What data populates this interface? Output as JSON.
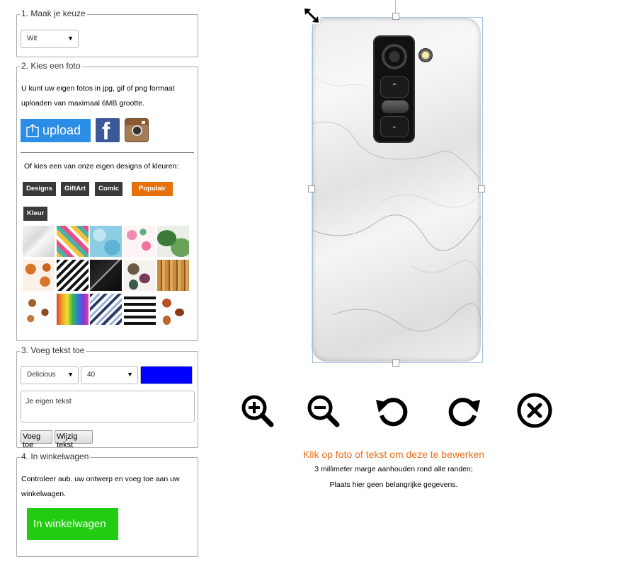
{
  "step1": {
    "legend": "1. Maak je keuze",
    "select_value": "Wit"
  },
  "step2": {
    "legend": "2. Kies een foto",
    "description": "U kunt uw eigen fotos in jpg, gif of png formaat uploaden van maximaal 6MB grootte.",
    "upload_label": "upload",
    "designs_intro": "Of kies een van onze eigen designs of kleuren:",
    "categories": [
      {
        "label": "Designs",
        "active": false
      },
      {
        "label": "GiftArt",
        "active": false
      },
      {
        "label": "Comic",
        "active": false
      },
      {
        "label": "Populair",
        "active": true
      }
    ],
    "kleur_label": "Kleur",
    "pattern_tiles": [
      {
        "name": "pattern-marble-white"
      },
      {
        "name": "pattern-pineapples"
      },
      {
        "name": "pattern-blue-glitter"
      },
      {
        "name": "pattern-flamingos"
      },
      {
        "name": "pattern-tropical-leaves"
      },
      {
        "name": "pattern-foxes"
      },
      {
        "name": "pattern-chevron-bw"
      },
      {
        "name": "pattern-marble-black"
      },
      {
        "name": "pattern-autumn-leaves"
      },
      {
        "name": "pattern-wood"
      },
      {
        "name": "pattern-dogs"
      },
      {
        "name": "pattern-rainbow-paint"
      },
      {
        "name": "pattern-chevron-blue"
      },
      {
        "name": "pattern-black-stripes"
      },
      {
        "name": "pattern-brown-leaves"
      }
    ]
  },
  "step3": {
    "legend": "3. Voeg tekst toe",
    "font_value": "Delicious",
    "size_value": "40",
    "color": "#0000ff",
    "textarea_value": "Je eigen tekst",
    "add_button": "Voeg toe",
    "edit_button": "Wijzig tekst"
  },
  "step4": {
    "legend": "4. In winkelwagen",
    "description": "Controleer aub. uw ontwerp en voeg toe aan uw winkelwagen.",
    "cart_button": "In winkelwagen"
  },
  "controls": [
    {
      "name": "zoom-in-icon"
    },
    {
      "name": "zoom-out-icon"
    },
    {
      "name": "rotate-left-icon"
    },
    {
      "name": "rotate-right-icon"
    },
    {
      "name": "delete-icon"
    }
  ],
  "info": {
    "edit_hint": "Klik op foto of tekst om deze te bewerken",
    "margin_note": "3 millimeter marge aanhouden rond alle randen;",
    "important_note": "Plaats hier geen belangrijke gegevens."
  },
  "colors": {
    "accent_orange": "#e8700a",
    "upload_blue": "#2a8de6",
    "cart_green": "#22cc11",
    "hint_orange": "#e8701a"
  }
}
